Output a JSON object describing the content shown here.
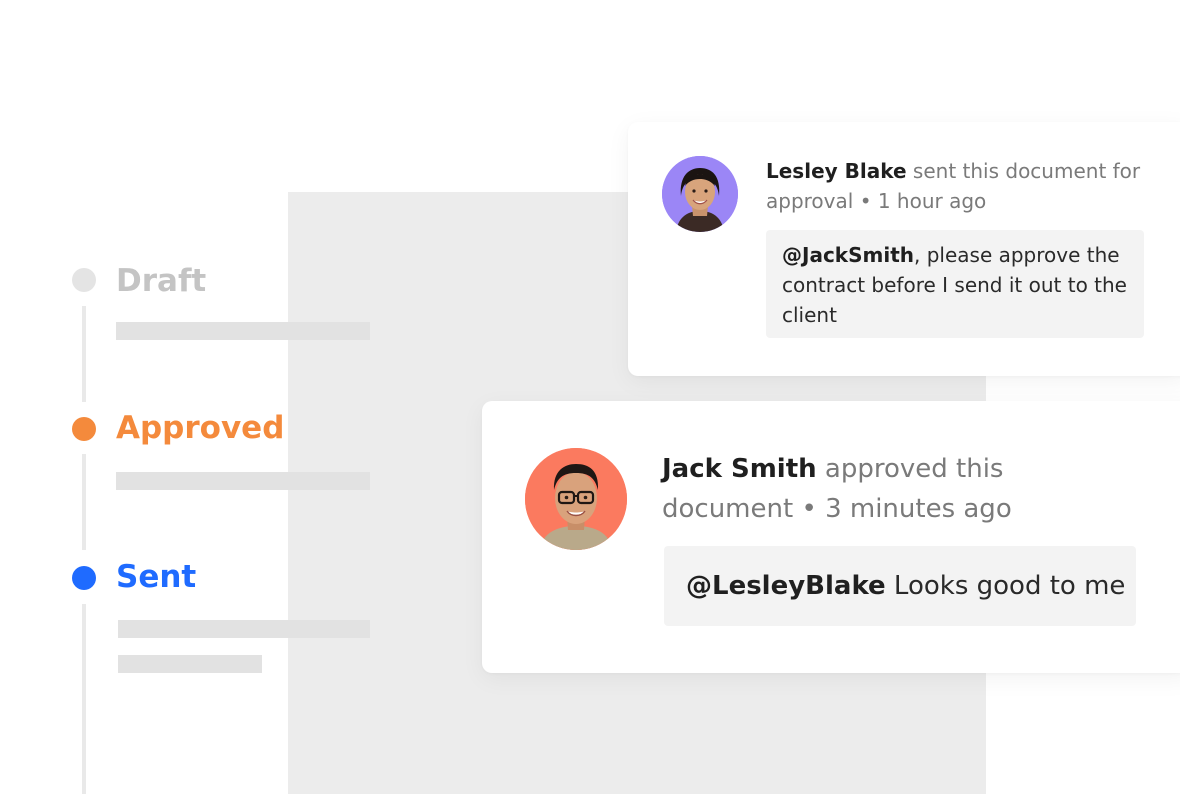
{
  "timeline": {
    "steps": [
      {
        "label": "Draft",
        "color": "#c4c4c4"
      },
      {
        "label": "Approved",
        "color": "#f48a3c"
      },
      {
        "label": "Sent",
        "color": "#1f6bff"
      }
    ],
    "line_color": "#e9e9e9",
    "bar_color": "#e2e2e2"
  },
  "document_background_color": "#ececec",
  "comments": [
    {
      "avatar_icon": "woman-portrait-avatar",
      "avatar_background": "#9b86f6",
      "author": "Lesley Blake",
      "action": "sent this document for approval",
      "separator": "•",
      "time": "1 hour ago",
      "mention": "@JackSmith",
      "message": ", please approve the contract before I send it out to the client"
    },
    {
      "avatar_icon": "man-with-glasses-portrait-avatar",
      "avatar_background": "#fb7a5f",
      "author": "Jack Smith",
      "action": "approved this document",
      "separator": "•",
      "time": "3 minutes ago",
      "mention": "@LesleyBlake",
      "message": " Looks good to me"
    }
  ]
}
